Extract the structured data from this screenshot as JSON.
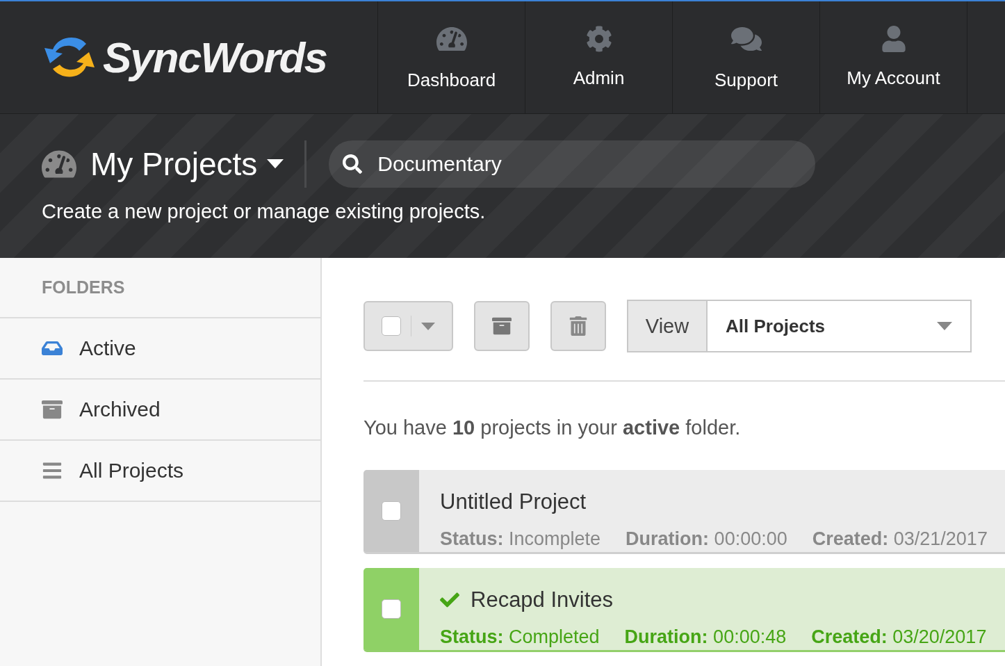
{
  "logo": {
    "text": "SyncWords"
  },
  "nav": [
    {
      "label": "Dashboard"
    },
    {
      "label": "Admin"
    },
    {
      "label": "Support"
    },
    {
      "label": "My Account"
    }
  ],
  "banner": {
    "title": "My Projects",
    "subtitle": "Create a new project or manage existing projects.",
    "search": {
      "value": "Documentary"
    }
  },
  "sidebar": {
    "heading": "FOLDERS",
    "items": [
      {
        "label": "Active",
        "selected": true
      },
      {
        "label": "Archived",
        "selected": false
      },
      {
        "label": "All Projects",
        "selected": false
      }
    ]
  },
  "toolbar": {
    "select_all": {
      "checked": false
    },
    "view_label": "View",
    "view_value": "All Projects"
  },
  "summary": "You have **10** projects in your **active** folder.",
  "projects": [
    {
      "kind": "incomplete",
      "title": "Untitled Project",
      "checked": false,
      "fields": [
        {
          "label": "Status:",
          "value": "Incomplete"
        },
        {
          "label": "Duration:",
          "value": "00:00:00"
        },
        {
          "label": "Created:",
          "value": "03/21/2017"
        }
      ]
    },
    {
      "kind": "completed",
      "title": "Recapd Invites",
      "checked": false,
      "fields": [
        {
          "label": "Status:",
          "value": "Completed"
        },
        {
          "label": "Duration:",
          "value": "00:00:48"
        },
        {
          "label": "Created:",
          "value": "03/20/2017"
        }
      ]
    }
  ]
}
